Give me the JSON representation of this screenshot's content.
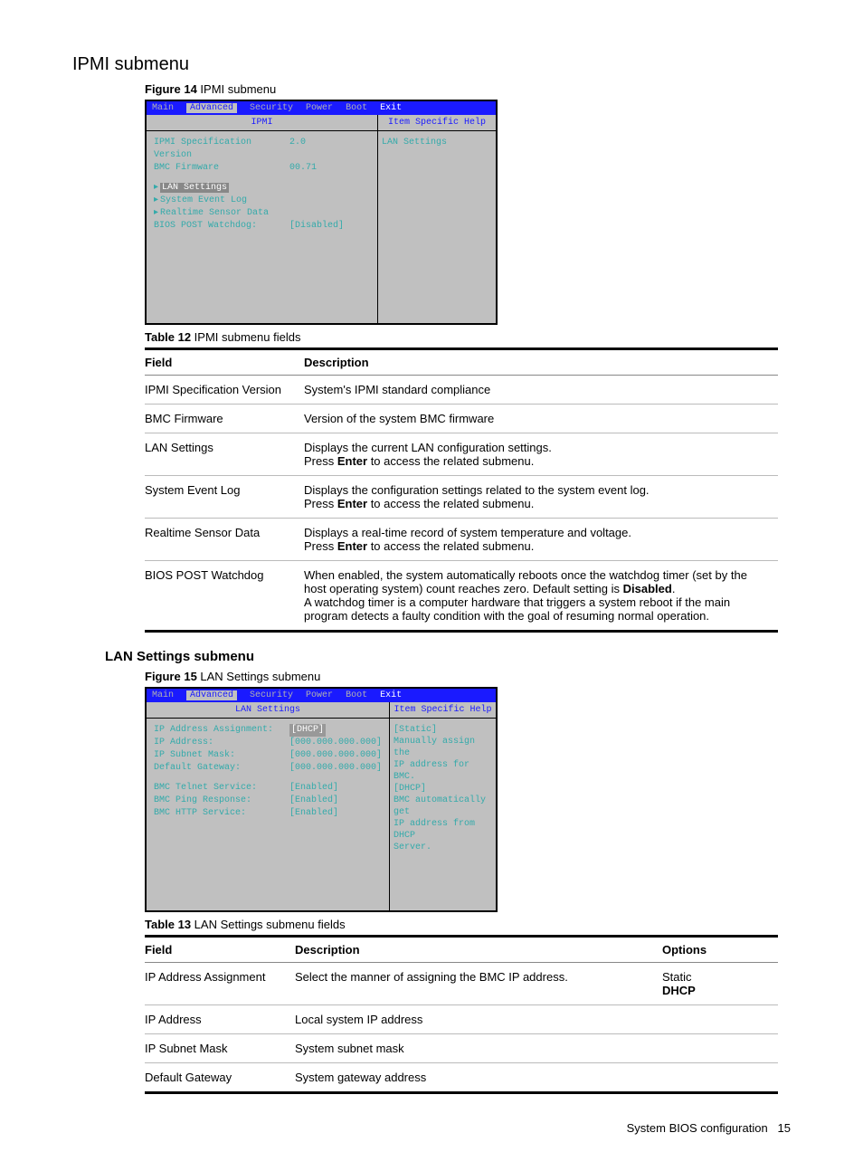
{
  "section_title": "IPMI submenu",
  "figure14": {
    "caption_bold": "Figure 14",
    "caption_rest": " IPMI submenu",
    "menubar": [
      "Main",
      "Advanced",
      "Security",
      "Power",
      "Boot",
      "Exit"
    ],
    "panel_title": "IPMI",
    "right_header": "Item Specific Help",
    "help_text": "LAN Settings",
    "rows": {
      "ipmi_spec_label": "IPMI Specification Version",
      "ipmi_spec_value": "2.0",
      "bmc_fw_label": "BMC Firmware",
      "bmc_fw_value": "00.71",
      "lan_settings": "LAN Settings",
      "sys_event_log": "System Event Log",
      "realtime_sensor": "Realtime Sensor Data",
      "watchdog_label": "BIOS POST Watchdog:",
      "watchdog_value": "[Disabled]"
    }
  },
  "table12": {
    "caption_bold": "Table 12",
    "caption_rest": " IPMI submenu fields",
    "header_field": "Field",
    "header_desc": "Description",
    "rows": [
      {
        "field": "IPMI Specification Version",
        "desc": "System's IPMI standard compliance"
      },
      {
        "field": "BMC Firmware",
        "desc": "Version of the system BMC firmware"
      },
      {
        "field": "LAN Settings",
        "desc_line1": "Displays the current LAN configuration settings.",
        "desc_prefix": "Press ",
        "desc_bold": "Enter",
        "desc_suffix": " to access the related submenu."
      },
      {
        "field": "System Event Log",
        "desc_line1": "Displays the configuration settings related to the system event log.",
        "desc_prefix": "Press ",
        "desc_bold": "Enter",
        "desc_suffix": " to access the related submenu."
      },
      {
        "field": "Realtime Sensor Data",
        "desc_line1": "Displays a real-time record of system temperature and voltage.",
        "desc_prefix": "Press ",
        "desc_bold": "Enter",
        "desc_suffix": " to access the related submenu."
      },
      {
        "field": "BIOS POST Watchdog",
        "desc_p1": "When enabled, the system automatically reboots once the watchdog timer (set by the host operating system) count reaches zero. Default setting is ",
        "desc_bold": "Disabled",
        "desc_p1b": ".",
        "desc_p2": "A watchdog timer is a computer hardware that triggers a system reboot if the main program detects a faulty condition with the goal of resuming normal operation."
      }
    ]
  },
  "subsection_title": "LAN Settings submenu",
  "figure15": {
    "caption_bold": "Figure 15",
    "caption_rest": " LAN Settings submenu",
    "menubar": [
      "Main",
      "Advanced",
      "Security",
      "Power",
      "Boot",
      "Exit"
    ],
    "panel_title": "LAN Settings",
    "right_header": "Item Specific Help",
    "help_lines": [
      "[Static]",
      " Manually assign the",
      " IP address for BMC.",
      "[DHCP]",
      " BMC automatically get",
      " IP address from DHCP",
      " Server."
    ],
    "rows": {
      "ip_assign_label": "IP Address Assignment:",
      "ip_assign_value": "[DHCP]",
      "ip_addr_label": "IP Address:",
      "ip_addr_value": "[000.000.000.000]",
      "subnet_label": "IP Subnet Mask:",
      "subnet_value": "[000.000.000.000]",
      "gateway_label": "Default Gateway:",
      "gateway_value": "[000.000.000.000]",
      "telnet_label": "BMC Telnet Service:",
      "telnet_value": "[Enabled]",
      "ping_label": "BMC Ping Response:",
      "ping_value": "[Enabled]",
      "http_label": "BMC HTTP Service:",
      "http_value": "[Enabled]"
    }
  },
  "table13": {
    "caption_bold": "Table 13",
    "caption_rest": " LAN Settings submenu fields",
    "header_field": "Field",
    "header_desc": "Description",
    "header_options": "Options",
    "rows": [
      {
        "field": "IP Address Assignment",
        "desc": "Select the manner of assigning the BMC IP address.",
        "opt1": "Static",
        "opt_bold": "DHCP"
      },
      {
        "field": "IP Address",
        "desc": "Local system IP address"
      },
      {
        "field": "IP Subnet Mask",
        "desc": "System subnet mask"
      },
      {
        "field": "Default Gateway",
        "desc": "System gateway address"
      }
    ]
  },
  "footer_text": "System BIOS configuration",
  "footer_page": "15"
}
